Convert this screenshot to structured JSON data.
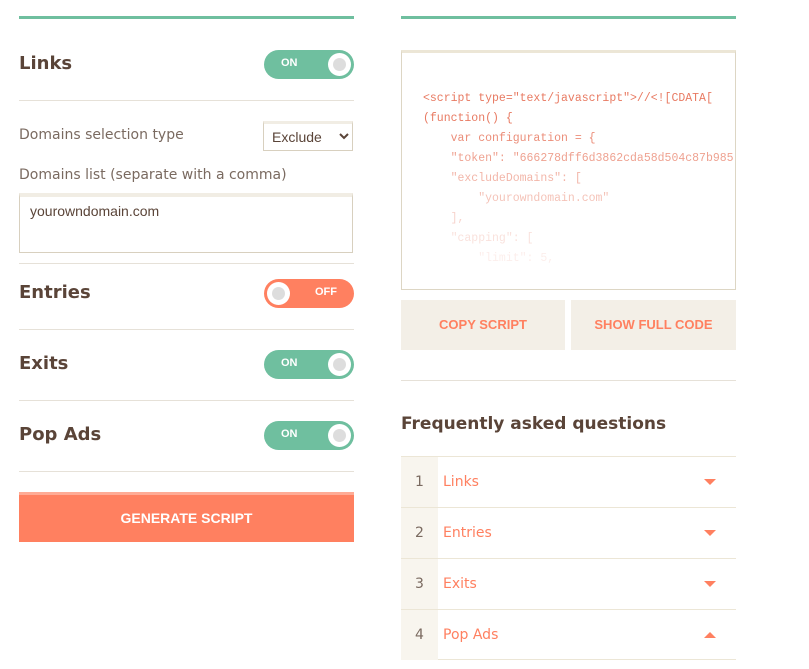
{
  "colors": {
    "accent_green": "#6fbf9f",
    "accent_orange": "#ff8060",
    "text_brown": "#5a4438"
  },
  "settings": {
    "links": {
      "title": "Links",
      "toggle": "ON"
    },
    "domains_selection_label": "Domains selection type",
    "domains_selection_value": "Exclude",
    "domains_list_label": "Domains list (separate with a comma)",
    "domains_list_value": "yourowndomain.com",
    "entries": {
      "title": "Entries",
      "toggle": "OFF"
    },
    "exits": {
      "title": "Exits",
      "toggle": "ON"
    },
    "pop_ads": {
      "title": "Pop Ads",
      "toggle": "ON"
    },
    "generate_label": "GENERATE SCRIPT"
  },
  "code": {
    "lines": [
      "<script type=\"text/javascript\">//<![CDATA[",
      "(function() {",
      "    var configuration = {",
      "    \"token\": \"666278dff6d3862cda58d504c87b985",
      "    \"excludeDomains\": [",
      "        \"yourowndomain.com\"",
      "    ],",
      "    \"capping\": [",
      "        \"limit\": 5,"
    ],
    "copy_label": "COPY SCRIPT",
    "show_full_label": "SHOW FULL CODE"
  },
  "faq": {
    "heading": "Frequently asked questions",
    "items": [
      {
        "num": "1",
        "label": "Links",
        "expanded": false
      },
      {
        "num": "2",
        "label": "Entries",
        "expanded": false
      },
      {
        "num": "3",
        "label": "Exits",
        "expanded": false
      },
      {
        "num": "4",
        "label": "Pop Ads",
        "expanded": true
      }
    ]
  }
}
